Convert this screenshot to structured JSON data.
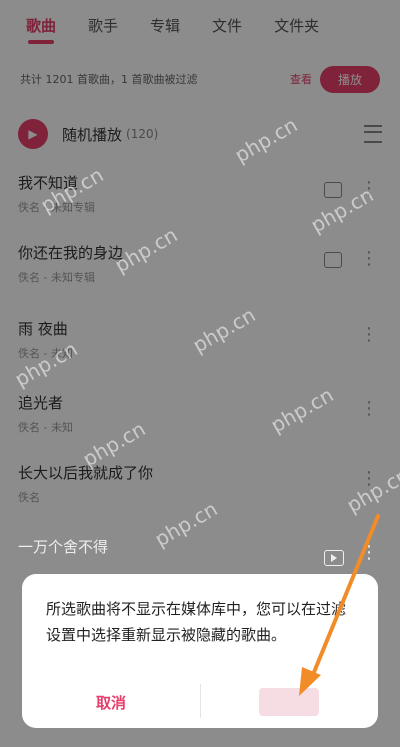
{
  "tabs": [
    "歌曲",
    "歌手",
    "专辑",
    "文件",
    "文件夹"
  ],
  "notice": {
    "text": "共计 1201 首歌曲，1 首歌曲被过滤",
    "link": "查看",
    "button": "播放"
  },
  "play_all": {
    "label": "随机播放",
    "count": "(120)"
  },
  "songs": [
    {
      "title": "我不知道",
      "artist": "佚名 - 未知专辑"
    },
    {
      "title": "你还在我的身边",
      "artist": "佚名 - 未知专辑"
    },
    {
      "title": "雨 夜曲",
      "artist": "佚名 - 未知"
    },
    {
      "title": "追光者",
      "artist": "佚名 - 未知"
    },
    {
      "title": "长大以后我就成了你",
      "artist": "佚名"
    }
  ],
  "peek_song": {
    "title": "一万个舍不得"
  },
  "dialog": {
    "message": "所选歌曲将不显示在媒体库中，您可以在过滤设置中选择重新显示被隐藏的歌曲。",
    "cancel": "取消",
    "confirm": ""
  },
  "watermark": "php.cn",
  "colors": {
    "accent": "#e83e6b",
    "arrow": "#f28c28"
  }
}
